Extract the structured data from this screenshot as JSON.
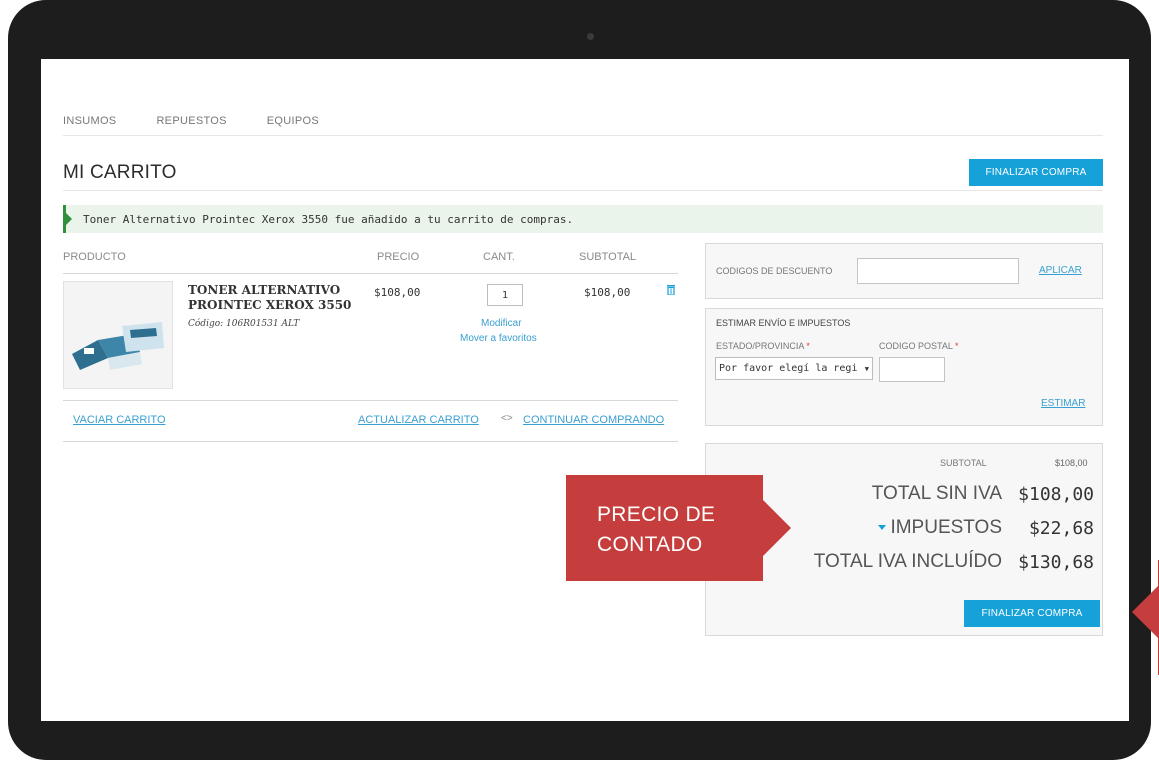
{
  "nav": {
    "items": [
      "INSUMOS",
      "REPUESTOS",
      "EQUIPOS"
    ]
  },
  "page": {
    "title": "MI CARRITO",
    "checkout_button": "FINALIZAR COMPRA"
  },
  "notice": {
    "message": "Toner Alternativo Prointec Xerox 3550 fue añadido a tu carrito de compras."
  },
  "table": {
    "headers": {
      "product": "PRODUCTO",
      "price": "PRECIO",
      "qty": "CANT.",
      "subtotal": "SUBTOTAL"
    },
    "rows": [
      {
        "name": "TONER ALTERNATIVO PROINTEC XEROX 3550",
        "code": "Código: 106R01531 ALT",
        "price": "$108,00",
        "qty": "1",
        "subtotal": "$108,00",
        "modify": "Modificar",
        "move_fav": "Mover a favoritos"
      }
    ]
  },
  "cart_actions": {
    "empty": "VACIAR CARRITO",
    "update": "ACTUALIZAR CARRITO",
    "separator": "<>",
    "continue": "CONTINUAR COMPRANDO"
  },
  "discount": {
    "label": "CODIGOS DE DESCUENTO",
    "input_value": "",
    "apply": "APLICAR"
  },
  "shipping": {
    "title": "ESTIMAR ENVÍO E IMPUESTOS",
    "state_label": "ESTADO/PROVINCIA",
    "state_value": "Por favor elegí la regi",
    "zip_label": "CODIGO POSTAL",
    "zip_value": "",
    "required_mark": "*",
    "estimate": "ESTIMAR"
  },
  "totals": {
    "subtotal_label": "SUBTOTAL",
    "subtotal_value": "$108,00",
    "net_label": "TOTAL SIN IVA",
    "net_value": "$108,00",
    "tax_label": "IMPUESTOS",
    "tax_value": "$22,68",
    "gross_label": "TOTAL IVA INCLUÍDO",
    "gross_value": "$130,68",
    "checkout_button": "FINALIZAR COMPRA"
  },
  "callout": {
    "line1": "PRECIO DE",
    "line2": "CONTADO"
  },
  "colors": {
    "accent": "#17a1d9",
    "callout": "#c63d3d",
    "notice_bg": "#eaf4ea",
    "notice_border": "#2f8f3b",
    "bezel": "#1d1d1d"
  }
}
